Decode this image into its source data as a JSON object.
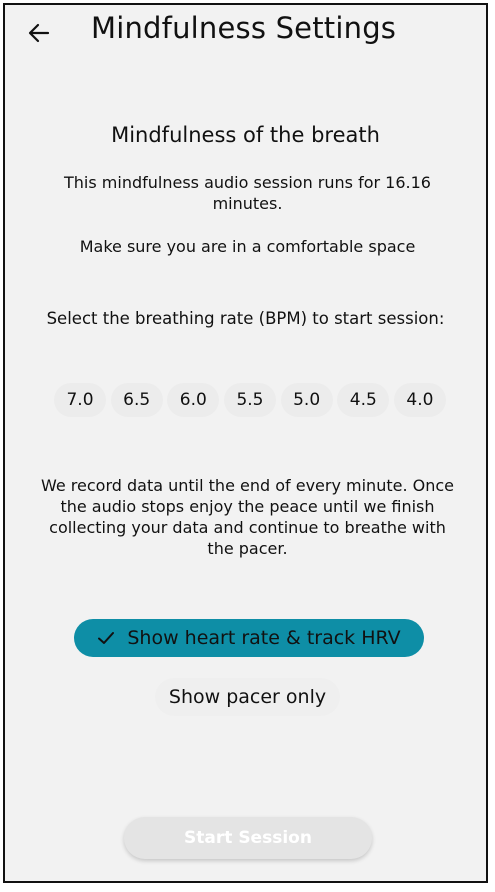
{
  "header": {
    "title": "Mindfulness Settings",
    "back_icon": "arrow-left-icon"
  },
  "session": {
    "title": "Mindfulness of the breath",
    "duration_text": "This mindfulness audio session runs for 16.16 minutes.",
    "comfort_text": "Make sure you are in a comfortable space"
  },
  "bpm": {
    "label": "Select the breathing rate (BPM) to start session:",
    "options": [
      "7.0",
      "6.5",
      "6.0",
      "5.5",
      "5.0",
      "4.5",
      "4.0"
    ]
  },
  "info_text": "We record data until the end of every minute. Once the audio stops enjoy the peace until we finish collecting your data and continue to breathe with the pacer.",
  "modes": {
    "selected_label": "Show heart rate & track HRV",
    "selected_icon": "checkmark-icon",
    "other_label": "Show pacer only"
  },
  "start_button": {
    "label": "Start Session"
  },
  "colors": {
    "accent": "#0e8ea6",
    "background": "#f2f2f2",
    "chip": "#ececec",
    "disabled_button": "#e4e4e4"
  }
}
